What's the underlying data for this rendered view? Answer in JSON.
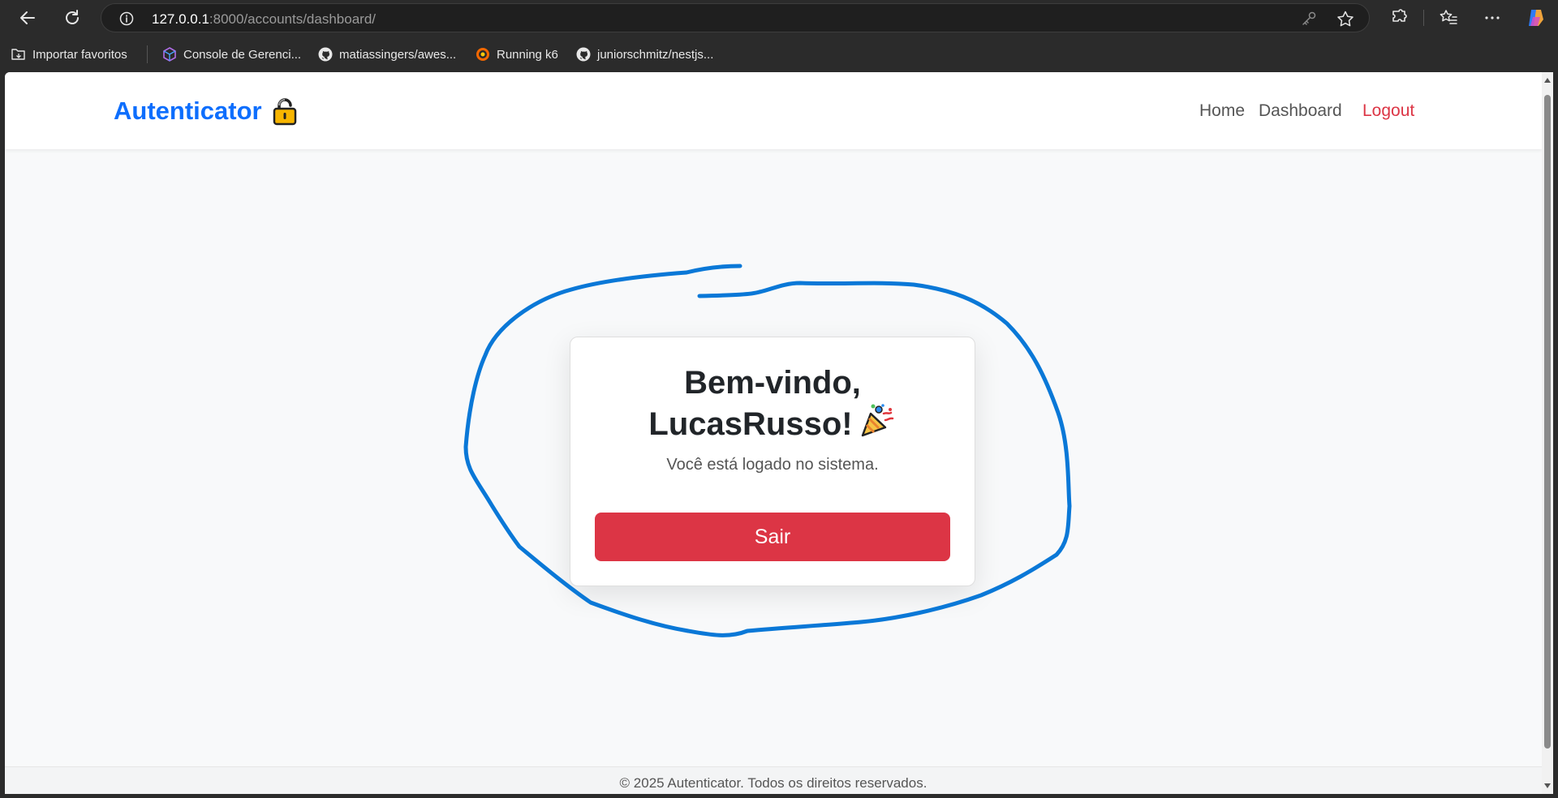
{
  "browser": {
    "url_host": "127.0.0.1",
    "url_rest": ":8000/accounts/dashboard/",
    "bookmarks": [
      {
        "label": "Importar favoritos",
        "icon": "folder-import-icon"
      },
      {
        "label": "Console de Gerenci...",
        "icon": "cube-icon"
      },
      {
        "label": "matiassingers/awes...",
        "icon": "github-icon"
      },
      {
        "label": "Running k6",
        "icon": "grafana-icon"
      },
      {
        "label": "juniorschmitz/nestjs...",
        "icon": "github-icon"
      }
    ]
  },
  "navbar": {
    "brand": "Autenticator",
    "brand_icon": "lock-icon",
    "links": {
      "home": "Home",
      "dashboard": "Dashboard",
      "logout": "Logout"
    }
  },
  "card": {
    "title_line1": "Bem-vindo,",
    "title_line2": "LucasRusso!",
    "title_icon": "party-popper-icon",
    "subtitle": "Você está logado no sistema.",
    "button": "Sair"
  },
  "footer": {
    "text": "© 2025 Autenticator. Todos os direitos reservados."
  },
  "colors": {
    "brand": "#0d6efd",
    "danger": "#dc3545",
    "annotation": "#0a78d7",
    "page_bg": "#f8f9fa"
  }
}
